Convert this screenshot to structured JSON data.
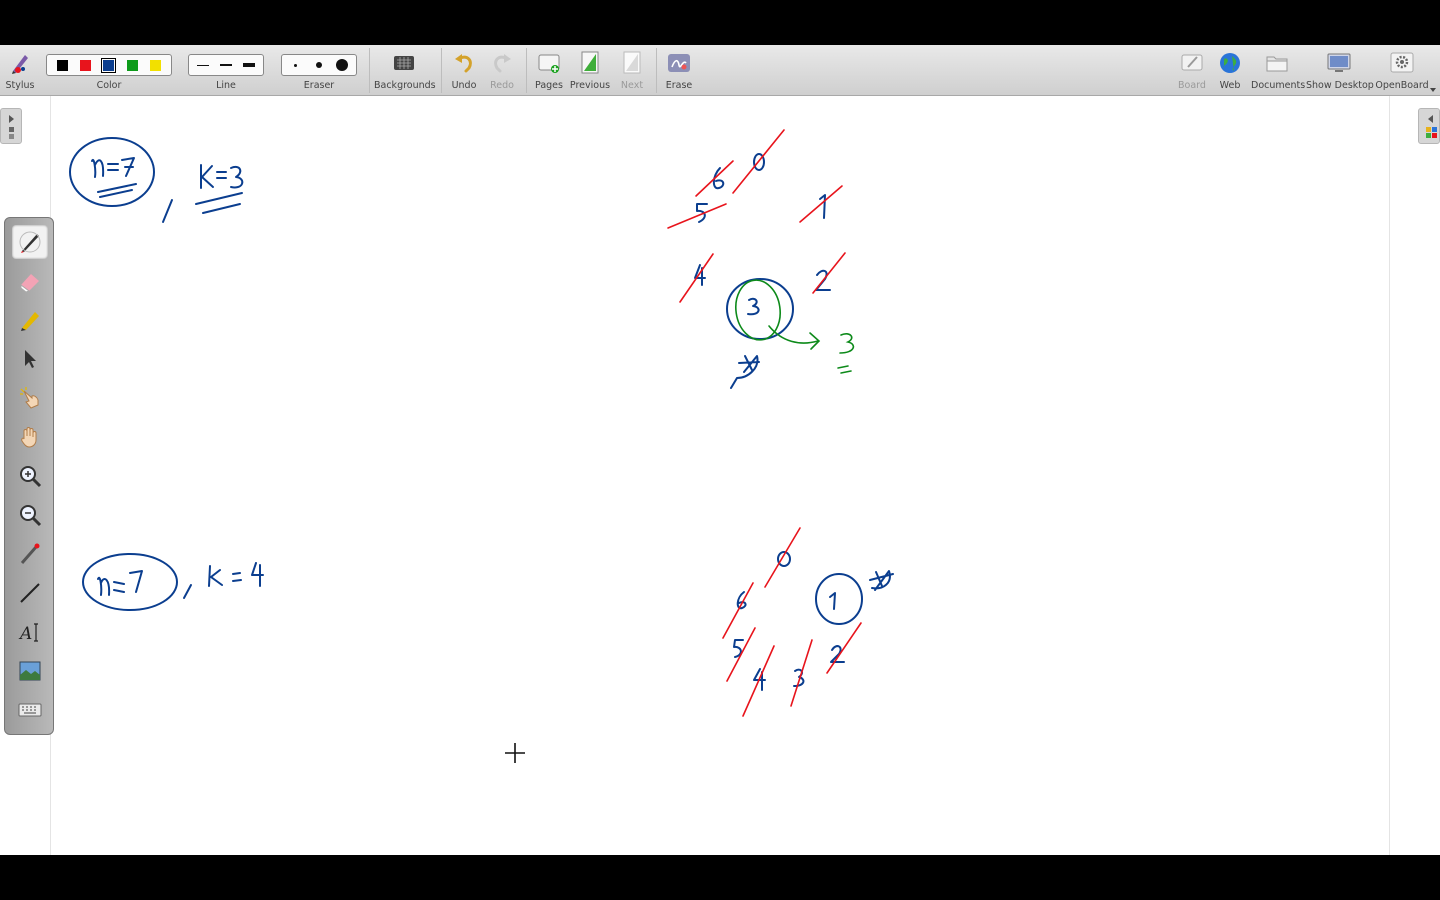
{
  "toolbar": {
    "stylus": "Stylus",
    "color": "Color",
    "line": "Line",
    "eraser": "Eraser",
    "backgrounds": "Backgrounds",
    "undo": "Undo",
    "redo": "Redo",
    "pages": "Pages",
    "previous": "Previous",
    "next": "Next",
    "erase": "Erase",
    "board": "Board",
    "web": "Web",
    "documents": "Documents",
    "show_desktop": "Show Desktop",
    "openboard": "OpenBoard"
  },
  "colors": [
    "#000000",
    "#e8141c",
    "#0b3e8f",
    "#0d9b1a",
    "#f2e000"
  ],
  "selected_color": "#0b3e8f",
  "ink_colors": {
    "blue": "#0b3e8f",
    "red": "#e8141c",
    "green": "#0d8a1a"
  },
  "palette_tools": [
    "pen-icon",
    "eraser-icon",
    "marker-icon",
    "selector-icon",
    "interactor-icon",
    "hand-icon",
    "zoom-in-icon",
    "zoom-out-icon",
    "laser-pointer-icon",
    "line-icon",
    "text-icon",
    "capture-icon",
    "keyboard-icon"
  ],
  "active_tool": "pen-icon",
  "board_text": {
    "n1": "n=7",
    "k1": "K=3",
    "n2": "n=7",
    "k2": "k=4",
    "top_nums": [
      "6",
      "0",
      "5",
      "1",
      "4",
      "2",
      "3",
      "8"
    ],
    "top_result": "3",
    "bottom_nums": [
      "0",
      "6",
      "5",
      "4",
      "3",
      "2",
      "1",
      "8"
    ]
  }
}
